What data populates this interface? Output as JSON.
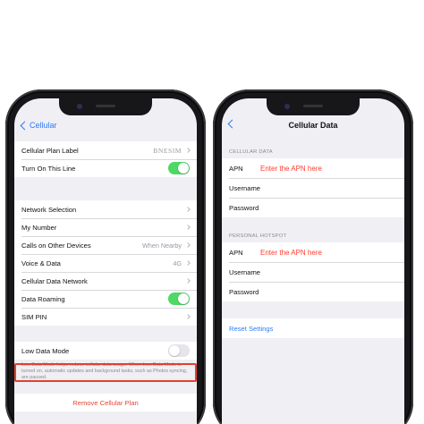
{
  "left_phone": {
    "back_label": "Cellular",
    "plan_group": [
      {
        "label": "Cellular Plan Label",
        "value": "BNESIM"
      },
      {
        "label": "Turn On This Line",
        "toggle": "on"
      }
    ],
    "network_group": [
      {
        "label": "Network Selection",
        "value": ""
      },
      {
        "label": "My Number",
        "value": ""
      },
      {
        "label": "Calls on Other Devices",
        "value": "When Nearby"
      },
      {
        "label": "Voice & Data",
        "value": "4G"
      },
      {
        "label": "Cellular Data Network",
        "value": "",
        "highlighted": true
      },
      {
        "label": "Data Roaming",
        "toggle": "on"
      },
      {
        "label": "SIM PIN",
        "value": ""
      }
    ],
    "low_data_group": {
      "label": "Low Data Mode",
      "toggle": "off"
    },
    "low_data_note": "Low Data Mode helps reduce cellular data usage. When Low Data Mode is turned on, automatic updates and background tasks, such as Photos syncing, are paused.",
    "remove_plan": "Remove Cellular Plan"
  },
  "right_phone": {
    "title": "Cellular Data",
    "cellular_data_header": "CELLULAR DATA",
    "cellular_data_rows": [
      {
        "label": "APN",
        "hint": "Enter the APN here"
      },
      {
        "label": "Username",
        "hint": ""
      },
      {
        "label": "Password",
        "hint": ""
      }
    ],
    "hotspot_header": "PERSONAL HOTSPOT",
    "hotspot_rows": [
      {
        "label": "APN",
        "hint": "Enter the APN here"
      },
      {
        "label": "Username",
        "hint": ""
      },
      {
        "label": "Password",
        "hint": ""
      }
    ],
    "reset_label": "Reset Settings"
  },
  "colors": {
    "accent_blue": "#2f7cf6",
    "toggle_on": "#4cd964",
    "highlight_red": "#e0412e",
    "destructive": "#e8473a",
    "hint_red": "#ff3b30"
  },
  "icons": [
    "chevron-left-icon",
    "chevron-right-icon",
    "front-camera-icon",
    "speaker-icon"
  ]
}
